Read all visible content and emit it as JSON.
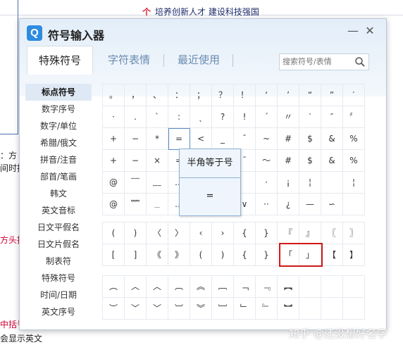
{
  "background": {
    "top_note": "培养创新人才 建设科技强国",
    "side_texts": [
      "：方",
      "间时接",
      "方头招",
      "中括号",
      "会显示英文"
    ]
  },
  "watermark": "知乎 @还没想好名字",
  "window": {
    "title": "符号输入器",
    "logo_letter": "Q",
    "minimize_glyph": "—",
    "close_glyph": "✕"
  },
  "tabs": [
    {
      "label": "特殊符号",
      "active": true
    },
    {
      "label": "字符表情",
      "active": false
    },
    {
      "label": "最近使用",
      "active": false
    }
  ],
  "search": {
    "placeholder": "搜索符号/表情"
  },
  "sidebar": [
    {
      "label": "标点符号",
      "active": true
    },
    {
      "label": "数字序号",
      "active": false
    },
    {
      "label": "数字/单位",
      "active": false
    },
    {
      "label": "希腊/俄文",
      "active": false
    },
    {
      "label": "拼音/注音",
      "active": false
    },
    {
      "label": "部首/笔画",
      "active": false
    },
    {
      "label": "韩文",
      "active": false
    },
    {
      "label": "英文音标",
      "active": false
    },
    {
      "label": "日文平假名",
      "active": false
    },
    {
      "label": "日文片假名",
      "active": false
    },
    {
      "label": "制表符",
      "active": false
    },
    {
      "label": "特殊符号",
      "active": false
    },
    {
      "label": "时间/日期",
      "active": false
    },
    {
      "label": "英文序号",
      "active": false
    }
  ],
  "grid1": [
    [
      "。",
      "，",
      "、",
      "：",
      "；",
      "？",
      "！",
      "‘",
      "’",
      "“",
      "”",
      "′"
    ],
    [
      "·",
      ".",
      "ˋ",
      ":",
      "ˎ",
      "?",
      "!",
      "ˊ",
      "〃",
      "‵",
      "″",
      "〞"
    ],
    [
      "+",
      "−",
      "*",
      "=",
      "<",
      "_",
      "¯",
      "~",
      "#",
      "$",
      "&",
      "%"
    ],
    [
      "+",
      "−",
      "×",
      "=",
      "<",
      "_",
      "ˉ",
      "～",
      "#",
      "$",
      "&",
      "%"
    ],
    [
      "@",
      "﹋",
      "﹏",
      "…",
      "",
      "",
      "",
      "·",
      "¡",
      "¦",
      "",
      "¦"
    ],
    [
      "@",
      "﹌",
      "﹍",
      "…",
      "",
      "",
      "∨",
      "··",
      "¿",
      "—",
      "∽",
      ""
    ]
  ],
  "grid2": [
    [
      "(",
      ")",
      "〈",
      "〉",
      "‹",
      "›",
      "{",
      "}",
      "『",
      "』",
      "〖",
      "〗"
    ],
    [
      "[",
      "]",
      "《",
      "》",
      "(",
      ")",
      "{",
      "}",
      "「",
      "」",
      "【",
      "】"
    ]
  ],
  "grid3": [
    [
      "︵",
      "︿",
      "︿",
      "︹",
      "︽",
      "﹇",
      "﹁",
      "﹃",
      "︻",
      "",
      "",
      ""
    ],
    [
      "︶",
      "﹀",
      "﹀",
      "︺",
      "︾",
      "﹈",
      "﹂",
      "﹄",
      "︼",
      "",
      "",
      ""
    ]
  ],
  "tooltip": {
    "title": "半角等于号",
    "symbol": "="
  }
}
